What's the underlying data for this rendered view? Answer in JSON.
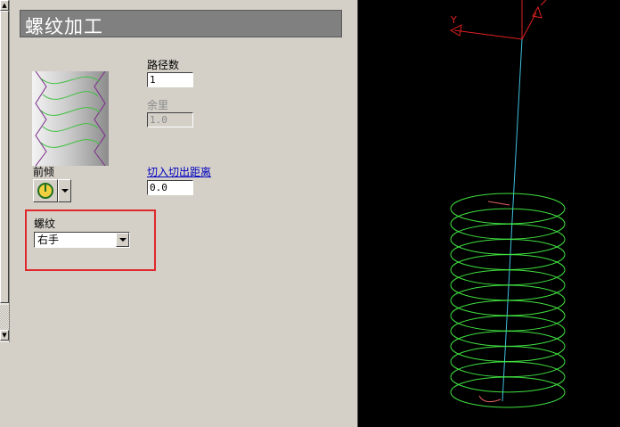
{
  "panel": {
    "title": "螺纹加工",
    "path_count": {
      "label": "路径数",
      "value": "1"
    },
    "allowance": {
      "label": "余里",
      "value": "1.0"
    },
    "front_angle": {
      "label": "前倾"
    },
    "lead_in_out": {
      "label": "切入切出距离",
      "value": "0.0"
    },
    "thread": {
      "label": "螺纹",
      "selected": "右手"
    }
  },
  "viewport": {
    "axis_y_label": "Y",
    "colors": {
      "background": "#000000",
      "helix": "#40e040",
      "axis": "#e02020",
      "tool_path": "#40c0e0",
      "ramp": "#e06060"
    }
  }
}
